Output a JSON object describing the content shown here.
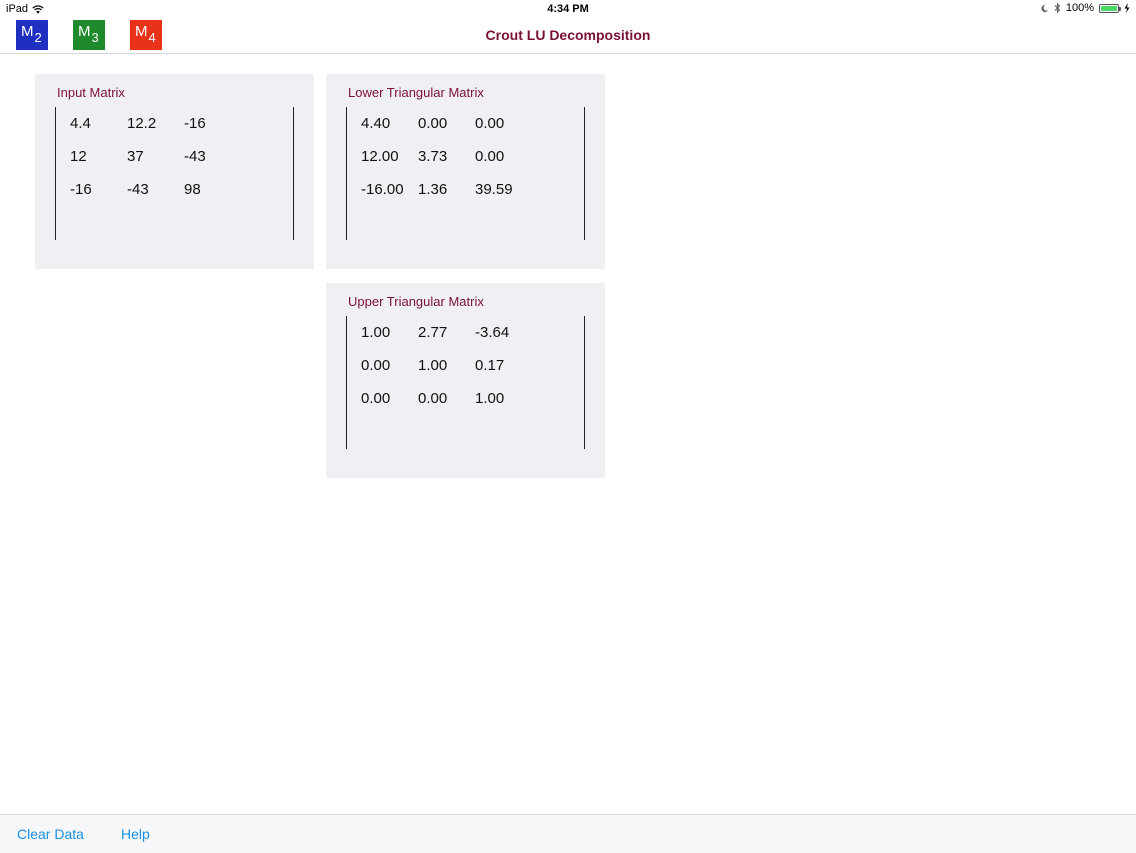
{
  "status": {
    "device": "iPad",
    "time": "4:34 PM",
    "battery": "100%"
  },
  "nav": {
    "title": "Crout LU Decomposition",
    "buttons": [
      {
        "letter": "M",
        "sub": "2",
        "color": "#1f2fbf"
      },
      {
        "letter": "M",
        "sub": "3",
        "color": "#1e8a2c"
      },
      {
        "letter": "M",
        "sub": "4",
        "color": "#e8321a"
      }
    ]
  },
  "panels": {
    "input": {
      "title": "Input Matrix",
      "rows": [
        [
          "4.4",
          "12.2",
          "-16"
        ],
        [
          "12",
          "37",
          "-43"
        ],
        [
          "-16",
          "-43",
          "98"
        ]
      ]
    },
    "lower": {
      "title": "Lower Triangular Matrix",
      "rows": [
        [
          "4.40",
          "0.00",
          "0.00"
        ],
        [
          "12.00",
          "3.73",
          "0.00"
        ],
        [
          "-16.00",
          "1.36",
          "39.59"
        ]
      ]
    },
    "upper": {
      "title": "Upper Triangular Matrix",
      "rows": [
        [
          "1.00",
          "2.77",
          "-3.64"
        ],
        [
          "0.00",
          "1.00",
          "0.17"
        ],
        [
          "0.00",
          "0.00",
          "1.00"
        ]
      ]
    }
  },
  "toolbar": {
    "clear_label": "Clear Data",
    "help_label": "Help"
  },
  "colors": {
    "title": "#7a1038",
    "link": "#1a8fe0",
    "panel_bg": "#f0f0f4"
  }
}
